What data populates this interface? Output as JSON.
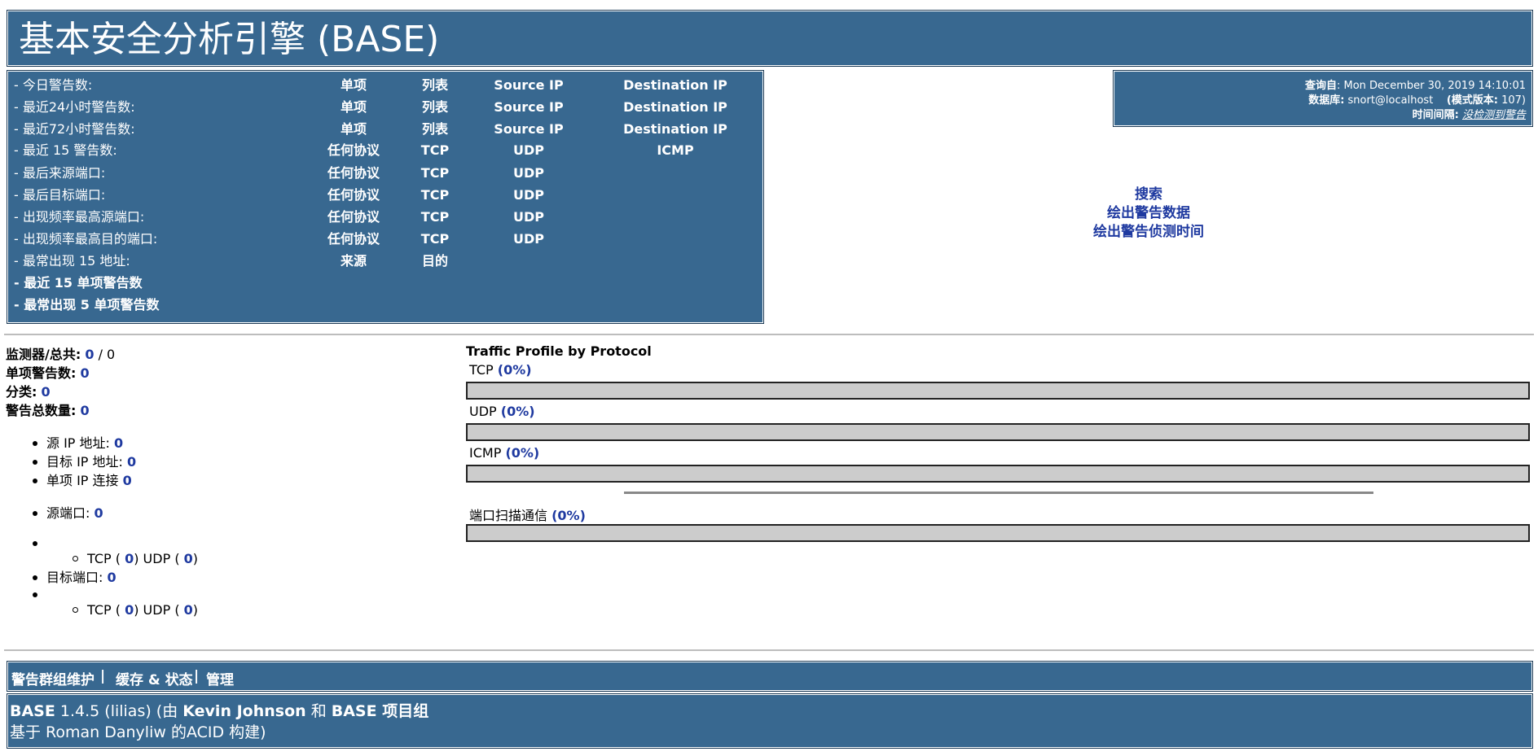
{
  "header": {
    "title": "基本安全分析引擎 (BASE)"
  },
  "menu": {
    "rows": [
      {
        "label": "- 今日警告数:",
        "c1": "单项",
        "c2": "列表",
        "c3": "Source IP",
        "c4": "Destination IP"
      },
      {
        "label": "- 最近24小时警告数:",
        "c1": "单项",
        "c2": "列表",
        "c3": "Source IP",
        "c4": "Destination IP"
      },
      {
        "label": "- 最近72小时警告数:",
        "c1": "单项",
        "c2": "列表",
        "c3": "Source IP",
        "c4": "Destination IP"
      },
      {
        "label": "- 最近 15 警告数:",
        "c1": "任何协议",
        "c2": "TCP",
        "c3": "UDP",
        "c4": "ICMP"
      },
      {
        "label": "- 最后来源端口:",
        "c1": "任何协议",
        "c2": "TCP",
        "c3": "UDP",
        "c4": ""
      },
      {
        "label": "- 最后目标端口:",
        "c1": "任何协议",
        "c2": "TCP",
        "c3": "UDP",
        "c4": ""
      },
      {
        "label": "- 出现频率最高源端口:",
        "c1": "任何协议",
        "c2": "TCP",
        "c3": "UDP",
        "c4": ""
      },
      {
        "label": "- 出现频率最高目的端口:",
        "c1": "任何协议",
        "c2": "TCP",
        "c3": "UDP",
        "c4": ""
      },
      {
        "label": "- 最常出现 15 地址:",
        "c1": "来源",
        "c2": "目的",
        "c3": "",
        "c4": ""
      },
      {
        "label": "- 最近 15 单项警告数",
        "c1": "",
        "c2": "",
        "c3": "",
        "c4": ""
      },
      {
        "label": "- 最常出现 5 单项警告数",
        "c1": "",
        "c2": "",
        "c3": "",
        "c4": ""
      }
    ]
  },
  "info": {
    "query_key": "查询自",
    "query_val": ": Mon December 30, 2019 14:10:01",
    "db_key": "数据库:",
    "db_val": " snort@localhost",
    "schema_key": "(模式版本:",
    "schema_val": " 107)",
    "time_key": "时间间隔:",
    "time_val": "没检测到警告"
  },
  "links": [
    "搜索",
    "绘出警告数据",
    "绘出警告侦测时间"
  ],
  "stats": {
    "sensors_key": "监测器/总共:",
    "sensors_val": "0",
    "sensors_sep": " / 0",
    "unique_key": "单项警告数:",
    "unique_val": "0",
    "cat_key": "分类:",
    "cat_val": "0",
    "total_key": "警告总数量:",
    "total_val": "0",
    "src_ip": "源 IP 地址:",
    "src_ip_val": "0",
    "dst_ip": "目标 IP 地址:",
    "dst_ip_val": "0",
    "uniq_conn": "单项 IP 连接",
    "uniq_conn_val": "0",
    "src_port": "源端口:",
    "src_port_val": "0",
    "dst_port": "目标端口:",
    "dst_port_val": "0",
    "tcp": "TCP (",
    "tcp_val": "0",
    "udp": ")  UDP (",
    "udp_val": "0",
    "close": ")"
  },
  "traffic": {
    "title": "Traffic Profile by Protocol",
    "protocols": [
      {
        "name": "TCP",
        "pct": "(0%)",
        "value": 0
      },
      {
        "name": "UDP",
        "pct": "(0%)",
        "value": 0
      },
      {
        "name": "ICMP",
        "pct": "(0%)",
        "value": 0
      }
    ],
    "portscan": {
      "name": "端口扫描通信",
      "pct": "(0%)",
      "value": 0
    }
  },
  "footer": {
    "nav": [
      "警告群组维护",
      "缓存 & 状态",
      "管理"
    ],
    "sep": "|",
    "line1_base": "BASE",
    "line1_ver": " 1.4.5 (lilias) (由 ",
    "line1_author": "Kevin Johnson",
    "line1_and": " 和 ",
    "line1_team": "BASE 项目组",
    "line2": "基于 Roman Danyliw 的ACID 构建)"
  }
}
